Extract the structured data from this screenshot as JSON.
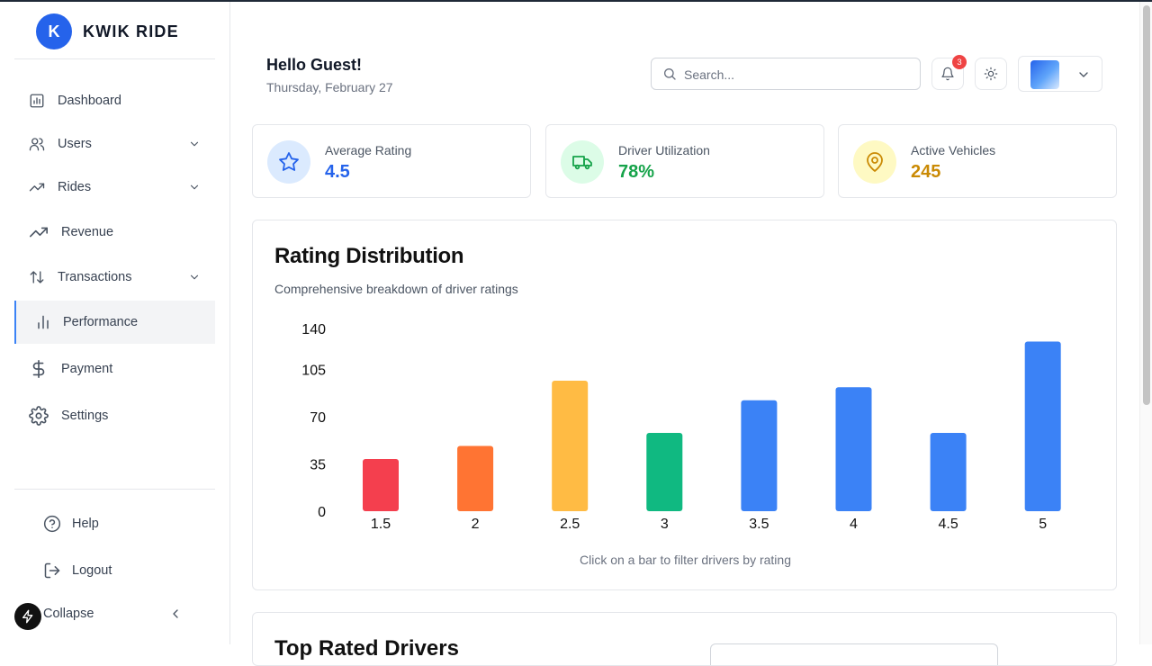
{
  "brand": {
    "initial": "K",
    "name": "KWIK RIDE"
  },
  "sidebar": {
    "items": [
      {
        "label": "Dashboard",
        "icon": "dashboard-icon"
      },
      {
        "label": "Users",
        "icon": "users-icon",
        "expandable": true
      },
      {
        "label": "Rides",
        "icon": "trending-up-icon",
        "expandable": true
      },
      {
        "label": "Revenue",
        "icon": "trending-up-icon"
      },
      {
        "label": "Transactions",
        "icon": "arrows-up-down-icon",
        "expandable": true
      },
      {
        "label": "Performance",
        "icon": "bar-chart-icon",
        "active": true
      },
      {
        "label": "Payment",
        "icon": "dollar-icon"
      },
      {
        "label": "Settings",
        "icon": "gear-icon"
      }
    ],
    "footer": [
      {
        "label": "Help",
        "icon": "help-circle-icon"
      },
      {
        "label": "Logout",
        "icon": "logout-icon"
      }
    ],
    "collapse_label": "Collapse"
  },
  "header": {
    "greeting": "Hello Guest!",
    "date": "Thursday, February 27",
    "search_placeholder": "Search...",
    "notification_count": "3"
  },
  "stats": [
    {
      "label": "Average Rating",
      "value": "4.5",
      "icon": "star-icon",
      "color": "#2563eb",
      "bg": "#dbeafe"
    },
    {
      "label": "Driver Utilization",
      "value": "78%",
      "icon": "truck-icon",
      "color": "#16a34a",
      "bg": "#dcfce7"
    },
    {
      "label": "Active Vehicles",
      "value": "245",
      "icon": "map-pin-icon",
      "color": "#ca8a04",
      "bg": "#fef9c3"
    }
  ],
  "rating_chart": {
    "title": "Rating Distribution",
    "subtitle": "Comprehensive breakdown of driver ratings",
    "note": "Click on a bar to filter drivers by rating"
  },
  "next_section": {
    "title": "Top Rated Drivers"
  },
  "chart_data": {
    "type": "bar",
    "title": "Rating Distribution",
    "subtitle": "Comprehensive breakdown of driver ratings",
    "xlabel": "",
    "ylabel": "",
    "categories": [
      "1.5",
      "2",
      "2.5",
      "3",
      "3.5",
      "4",
      "4.5",
      "5"
    ],
    "values": [
      40,
      50,
      100,
      60,
      85,
      95,
      60,
      130
    ],
    "colors": [
      "#f43f4e",
      "#ff7433",
      "#ffbb44",
      "#10b981",
      "#3b82f6",
      "#3b82f6",
      "#3b82f6",
      "#3b82f6"
    ],
    "yticks": [
      "0",
      "35",
      "70",
      "105",
      "140"
    ],
    "ylim": [
      0,
      140
    ],
    "grid": false,
    "legend": "none"
  }
}
